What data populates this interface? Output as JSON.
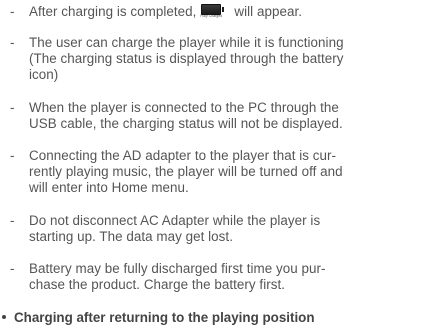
{
  "notes": [
    {
      "dash": "-",
      "line1_before": "After charging is completed,",
      "line1_after": "will appear.",
      "icon": "battery-full-icon",
      "icon_label": "Fully Charged"
    },
    {
      "dash": "-",
      "lines": [
        "The user can charge the player while it is functioning",
        "(The charging status is displayed through the battery",
        "icon)"
      ]
    },
    {
      "dash": "-",
      "lines": [
        "When the player is connected to the PC through the",
        "USB cable, the charging status will not be displayed."
      ]
    },
    {
      "dash": "-",
      "lines": [
        "Connecting the AD adapter to the player that is cur-",
        "rently playing music, the player will be turned off and",
        "will enter into Home menu."
      ]
    },
    {
      "dash": "-",
      "lines": [
        "Do not disconnect AC Adapter while the player is",
        "starting up. The data may get lost."
      ]
    },
    {
      "dash": "-",
      "lines": [
        "Battery may be fully discharged first time you pur-",
        "chase the product. Charge the battery first."
      ]
    }
  ],
  "section_heading": "Charging after returning to the playing position"
}
